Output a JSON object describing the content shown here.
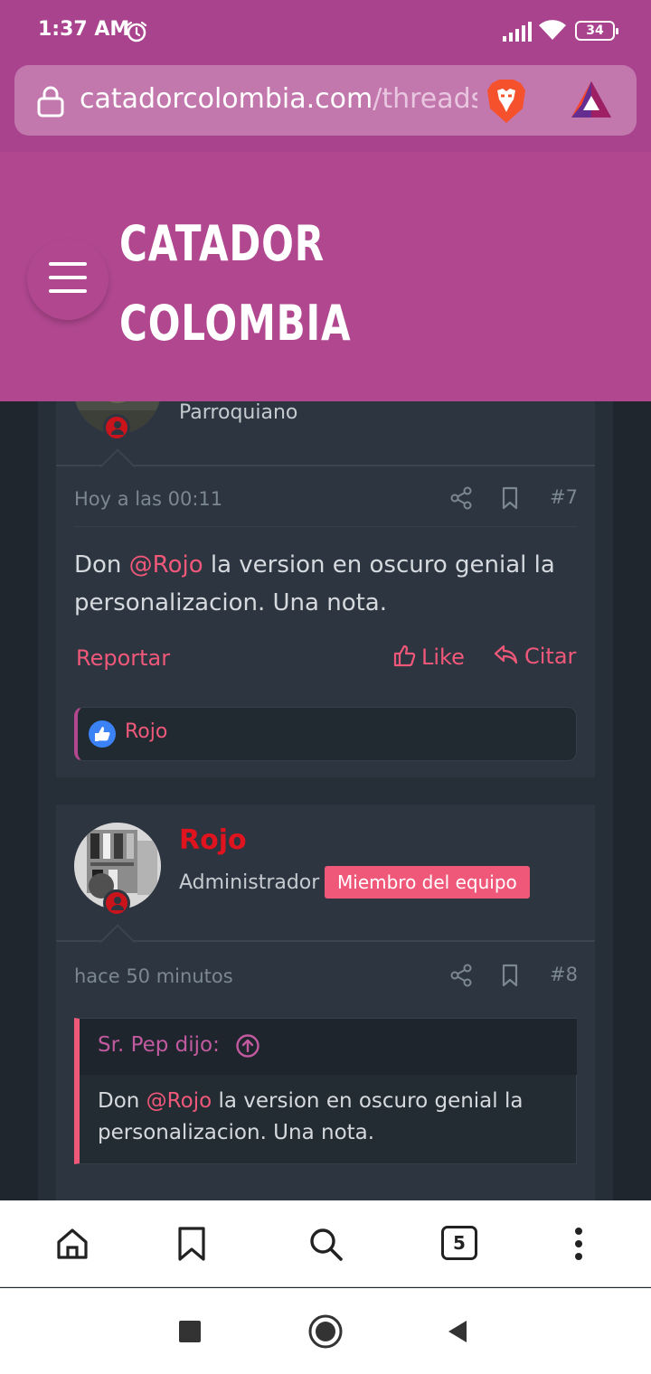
{
  "status_bar": {
    "time": "1:37 AM",
    "battery": "34"
  },
  "browser": {
    "url_domain": "catadorcolombia.com",
    "url_path": "/threads",
    "tab_count": "5"
  },
  "site": {
    "logo_line1": "CATADOR",
    "logo_line2": "COLOMBIA",
    "colors": {
      "header": "#b0478f",
      "accent": "#f0587a",
      "admin": "#e0141e"
    }
  },
  "post7": {
    "user_title": "Parroquiano",
    "date": "Hoy a las 00:11",
    "number": "#7",
    "message_before": "Don ",
    "mention": "@Rojo",
    "message_after": " la version en oscuro genial la personalizacion. Una nota.",
    "report_label": "Reportar",
    "like_label": "Like",
    "quote_label": "Citar",
    "reacted_by": "Rojo"
  },
  "post8": {
    "username": "Rojo",
    "user_title": "Administrador",
    "badge": "Miembro del equipo",
    "date": "hace 50 minutos",
    "number": "#8",
    "quote_author": "Sr. Pep dijo:",
    "quote_before": "Don ",
    "quote_mention": "@Rojo",
    "quote_after": " la version en oscuro genial la personalizacion. Una nota."
  }
}
